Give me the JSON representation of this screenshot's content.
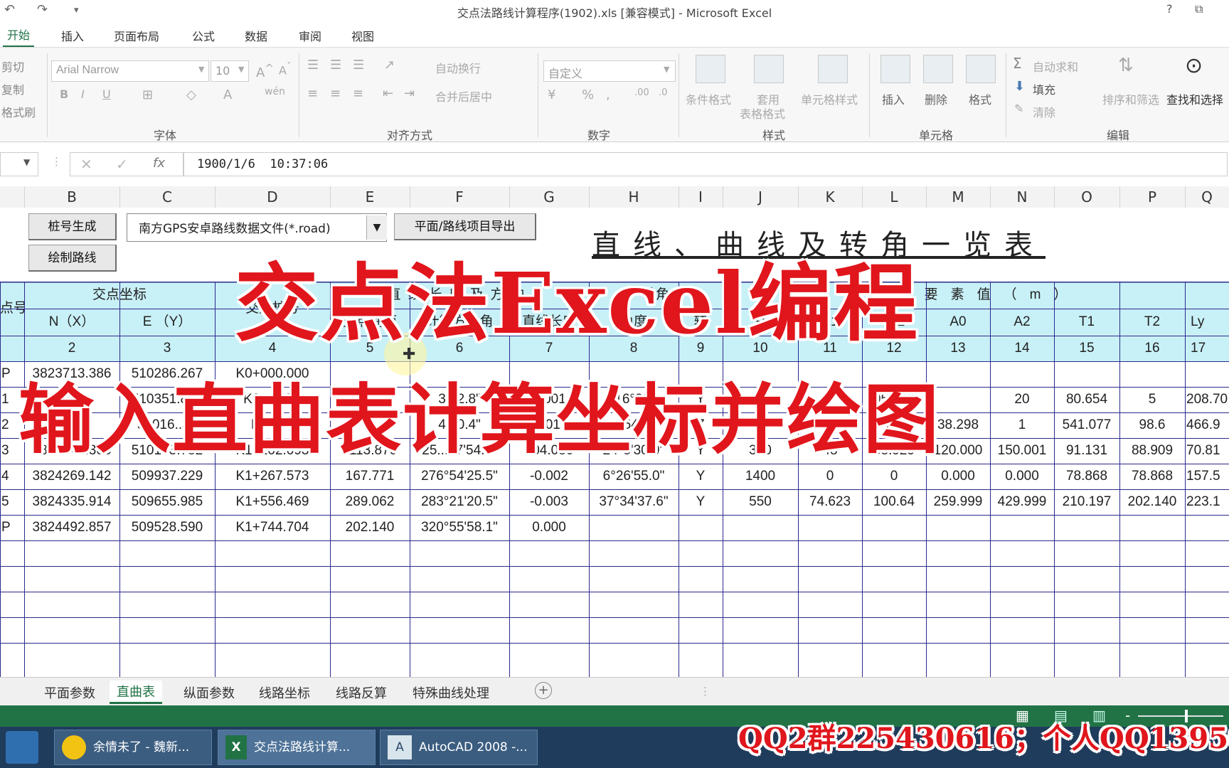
{
  "window": {
    "title": "交点法路线计算程序(1902).xls  [兼容模式] - Microsoft Excel",
    "help": "?",
    "restore": "⧉"
  },
  "ribbon_tabs": [
    "开始",
    "插入",
    "页面布局",
    "公式",
    "数据",
    "审阅",
    "视图"
  ],
  "ribbon": {
    "clipboard": [
      "剪切",
      "复制",
      "格式刷"
    ],
    "font_name": "Arial Narrow",
    "font_size": "10",
    "font_group": "字体",
    "align_group": "对齐方式",
    "wrap": "自动换行",
    "merge": "合并后居中",
    "number_format": "自定义",
    "number_group": "数字",
    "cond_format": "条件格式",
    "table_format_1": "套用",
    "table_format_2": "表格格式",
    "cell_style": "单元格样式",
    "styles_group": "样式",
    "insert": "插入",
    "delete": "删除",
    "format": "格式",
    "cells_group": "单元格",
    "autosum": "自动求和",
    "fill": "填充",
    "clear": "清除",
    "sort": "排序和筛选",
    "find": "查找和选择",
    "edit_group": "编辑"
  },
  "formula_bar": {
    "value": "1900/1/6  10:37:06"
  },
  "columns": [
    "B",
    "C",
    "D",
    "E",
    "F",
    "G",
    "H",
    "I",
    "J",
    "K",
    "L",
    "M",
    "N",
    "O",
    "P",
    "Q"
  ],
  "controls": {
    "btn_stake": "桩号生成",
    "btn_draw": "绘制路线",
    "combo": "南方GPS安卓路线数据文件(*.road)",
    "btn_export": "平面/路线项目导出",
    "sheet_title": "直线、曲线及转角一览表"
  },
  "table": {
    "h_num": "点号",
    "h_coord": "交点坐标",
    "h_nx": "N（X）",
    "h_ey": "E （Y）",
    "h_stake": "交点桩号",
    "h_line": "直线长度及方向",
    "h_turn": "转角",
    "h_curve": "曲线要素值（m）",
    "h_e": "交点间距",
    "h_f": "计算方位角",
    "h_g": "直线长度",
    "h_h": "角度",
    "h_i": "转",
    "h_j": "R",
    "h_k": "A1",
    "h_l": "Ls2",
    "h_m": "A0",
    "h_n": "A2",
    "h_o": "T1",
    "h_p": "T2",
    "h_q": "Ly",
    "idx": [
      "2",
      "3",
      "4",
      "5",
      "6",
      "7",
      "8",
      "9",
      "10",
      "11",
      "12",
      "13",
      "14",
      "15",
      "16",
      "17"
    ],
    "rows": [
      {
        "a": "P",
        "b": "3823713.386",
        "c": "510286.267",
        "d": "K0+000.000",
        "e": "",
        "f": "",
        "g": "",
        "h": "",
        "i": "",
        "j": "",
        "k": "",
        "l": "",
        "m": "",
        "n": "",
        "o": "",
        "p": "",
        "q": ""
      },
      {
        "a": "1",
        "b": "3823",
        "c": "510351.859",
        "d": "K0+...655",
        "e": "",
        "f": "3...2.8\"",
        "g": "0.001",
        "h": "16°26'",
        "i": "Y",
        "j": "",
        "k": "",
        "l": "95.632",
        "m": "",
        "n": "20",
        "o": "80.654",
        "p": "5",
        "q": "208.70"
      },
      {
        "a": "2",
        "b": "",
        "c": "51016..36",
        "d": "K...415",
        "e": "",
        "f": "4...0.4\"",
        "g": "001",
        "h": "154°3",
        "i": "Z",
        "j": "",
        "k": "",
        "l": "50",
        "m": "38.298",
        "n": "1",
        "o": "541.077",
        "p": "98.6",
        "q": "466.9"
      },
      {
        "a": "3",
        "b": "3824248.306",
        "c": "510103.782",
        "d": "K1+102.093",
        "e": "1113.870",
        "f": "25...57'54.6\"",
        "g": "104.080",
        "h": "24°5'30.9\"",
        "i": "Y",
        "j": "300",
        "k": "48",
        "l": "58.929",
        "m": "120.000",
        "n": "150.001",
        "o": "91.131",
        "p": "88.909",
        "q": "70.81"
      },
      {
        "a": "4",
        "b": "3824269.142",
        "c": "509937.229",
        "d": "K1+267.573",
        "e": "167.771",
        "f": "276°54'25.5\"",
        "g": "-0.002",
        "h": "6°26'55.0\"",
        "i": "Y",
        "j": "1400",
        "k": "0",
        "l": "0",
        "m": "0.000",
        "n": "0.000",
        "o": "78.868",
        "p": "78.868",
        "q": "157.5"
      },
      {
        "a": "5",
        "b": "3824335.914",
        "c": "509655.985",
        "d": "K1+556.469",
        "e": "289.062",
        "f": "283°21'20.5\"",
        "g": "-0.003",
        "h": "37°34'37.6\"",
        "i": "Y",
        "j": "550",
        "k": "74.623",
        "l": "100.64",
        "m": "259.999",
        "n": "429.999",
        "o": "210.197",
        "p": "202.140",
        "q": "223.1"
      },
      {
        "a": "P",
        "b": "3824492.857",
        "c": "509528.590",
        "d": "K1+744.704",
        "e": "202.140",
        "f": "320°55'58.1\"",
        "g": "0.000",
        "h": "",
        "i": "",
        "j": "",
        "k": "",
        "l": "",
        "m": "",
        "n": "",
        "o": "",
        "p": "",
        "q": ""
      }
    ]
  },
  "sheet_tabs": [
    "平面参数",
    "直曲表",
    "纵面参数",
    "线路坐标",
    "线路反算",
    "特殊曲线处理"
  ],
  "active_sheet": "直曲表",
  "taskbar": {
    "task1": "余情未了 - 魏新...",
    "task2": "交点法路线计算...",
    "task3": "AutoCAD 2008 -..."
  },
  "overlay": {
    "line1": "交点法Excel编程",
    "line2": "输入直曲表计算坐标并绘图",
    "qq": "QQ2群225430616；个人QQ1395009"
  },
  "colors": {
    "excel_green": "#217346",
    "header_fill": "#c8f0f7",
    "grid_line": "#2b2b8c",
    "overlay_red": "#e0161c"
  }
}
